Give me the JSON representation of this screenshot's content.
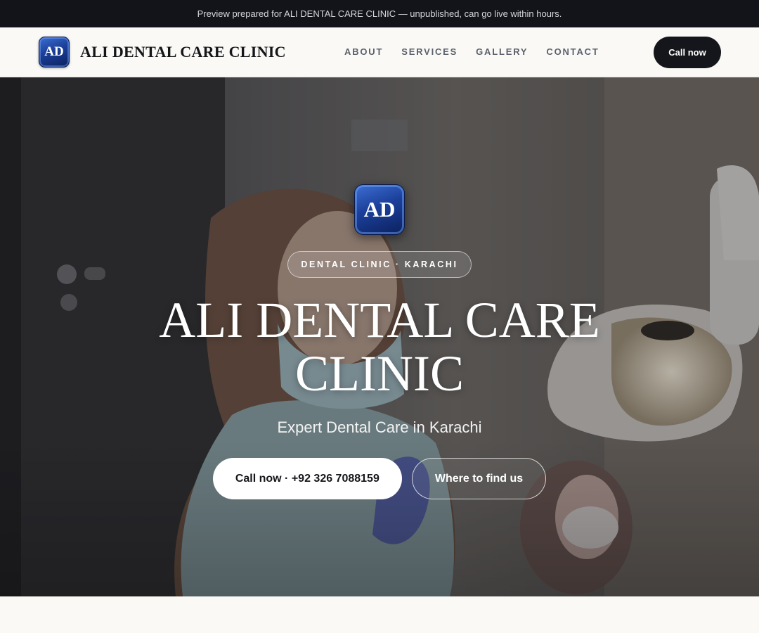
{
  "preview_bar": {
    "text": "Preview prepared for ALI DENTAL CARE CLINIC — unpublished, can go live within hours."
  },
  "header": {
    "logo_text": "AD",
    "brand_name": "ALI DENTAL CARE CLINIC",
    "nav": [
      {
        "label": "ABOUT"
      },
      {
        "label": "SERVICES"
      },
      {
        "label": "GALLERY"
      },
      {
        "label": "CONTACT"
      }
    ],
    "cta_label": "Call now"
  },
  "hero": {
    "logo_text": "AD",
    "tag": "DENTAL CLINIC · KARACHI",
    "title": "ALI DENTAL CARE CLINIC",
    "subtitle": "Expert Dental Care in Karachi",
    "primary_button": "Call now · +92 326 7088159",
    "secondary_button": "Where to find us"
  },
  "colors": {
    "dark": "#14161b",
    "page_bg": "#faf9f6",
    "brand_blue": "#1b3f99"
  }
}
